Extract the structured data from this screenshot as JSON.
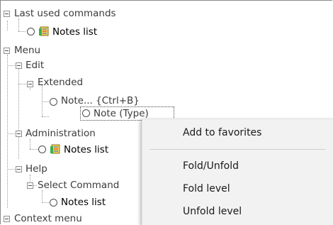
{
  "tree": {
    "last_used": "Last used commands",
    "notes_list_1": "Notes list",
    "menu": "Menu",
    "edit": "Edit",
    "extended": "Extended",
    "note_ctrlb": "Note... {Ctrl+B}",
    "note_type": "Note (Type)",
    "administration": "Administration",
    "notes_list_2": "Notes list",
    "help": "Help",
    "select_command": "Select Command",
    "notes_list_3": "Notes list",
    "context_menu": "Context menu"
  },
  "context_menu": {
    "items": [
      "Add to favorites",
      "Fold/Unfold",
      "Fold level",
      "Unfold level"
    ]
  },
  "icons": {
    "expander": "minus-box-icon",
    "radio": "radio-icon",
    "book": "notes-book-icon"
  }
}
